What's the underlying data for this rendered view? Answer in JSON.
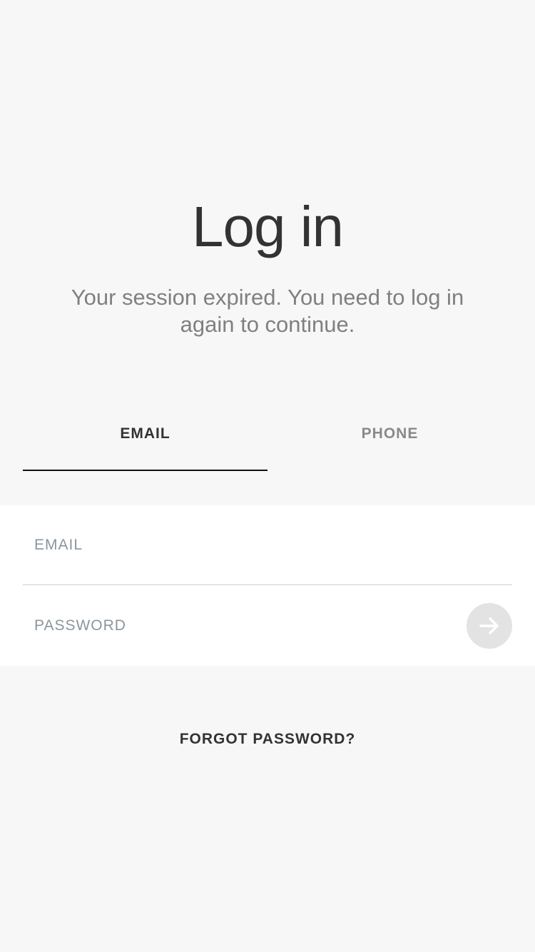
{
  "header": {
    "title": "Log in",
    "subtitle": "Your session expired. You need to log in again to continue."
  },
  "tabs": [
    {
      "label": "EMAIL",
      "active": true
    },
    {
      "label": "PHONE",
      "active": false
    }
  ],
  "form": {
    "email_placeholder": "EMAIL",
    "email_value": "",
    "password_placeholder": "PASSWORD",
    "password_value": "",
    "submit_icon": "arrow-right-icon"
  },
  "links": {
    "forgot_password": "FORGOT PASSWORD?"
  },
  "colors": {
    "background": "#f7f7f7",
    "card": "#ffffff",
    "text_primary": "#333333",
    "text_secondary": "#808080",
    "submit_bg": "#e3e3e3"
  }
}
